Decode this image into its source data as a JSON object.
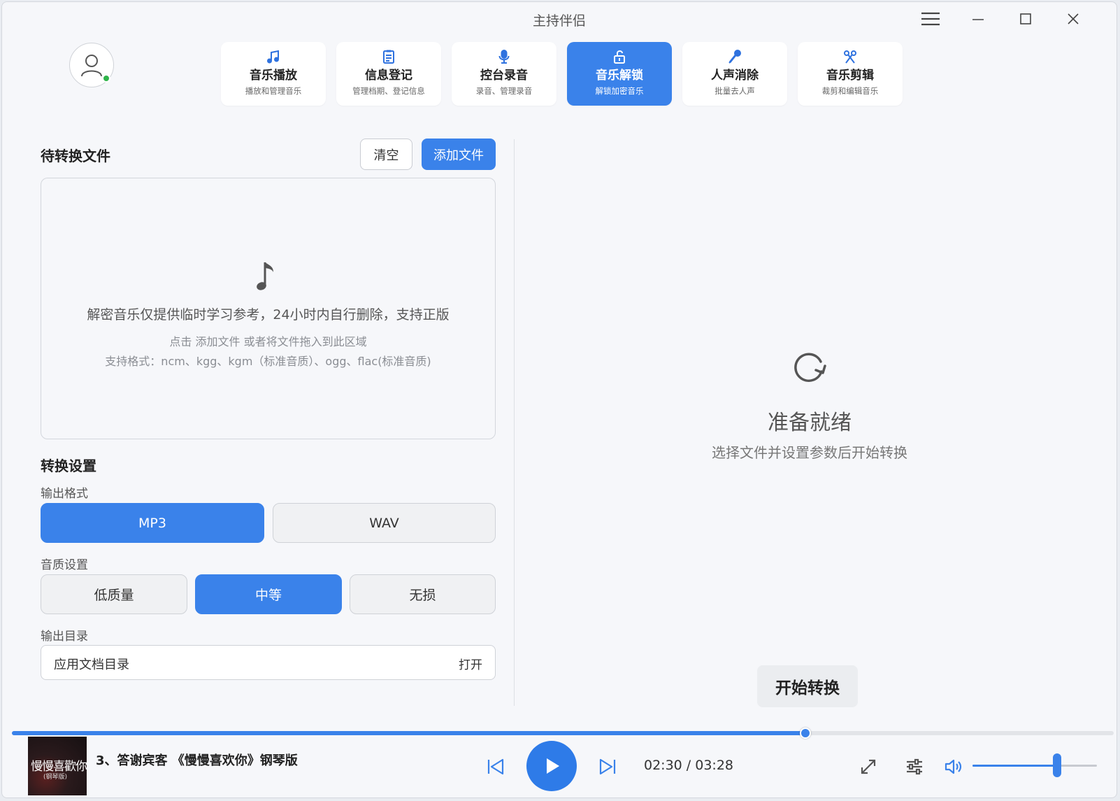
{
  "window": {
    "title": "主持伴侣"
  },
  "nav": [
    {
      "label": "音乐播放",
      "sub": "播放和管理音乐",
      "icon": "music-note-icon",
      "active": false
    },
    {
      "label": "信息登记",
      "sub": "管理档期、登记信息",
      "icon": "clipboard-icon",
      "active": false
    },
    {
      "label": "控台录音",
      "sub": "录音、管理录音",
      "icon": "microphone-icon",
      "active": false
    },
    {
      "label": "音乐解锁",
      "sub": "解锁加密音乐",
      "icon": "unlock-icon",
      "active": true
    },
    {
      "label": "人声消除",
      "sub": "批量去人声",
      "icon": "mic-remove-icon",
      "active": false
    },
    {
      "label": "音乐剪辑",
      "sub": "裁剪和编辑音乐",
      "icon": "scissors-icon",
      "active": false
    }
  ],
  "files": {
    "title": "待转换文件",
    "clear_label": "清空",
    "add_label": "添加文件",
    "note": "解密音乐仅提供临时学习参考，24小时内自行删除，支持正版",
    "hint": "点击 添加文件 或者将文件拖入到此区域",
    "formats": "支持格式：ncm、kgg、kgm（标准音质）、ogg、flac(标准音质)"
  },
  "settings": {
    "title": "转换设置",
    "format_label": "输出格式",
    "formats": [
      {
        "label": "MP3",
        "active": true
      },
      {
        "label": "WAV",
        "active": false
      }
    ],
    "quality_label": "音质设置",
    "qualities": [
      {
        "label": "低质量",
        "active": false
      },
      {
        "label": "中等",
        "active": true
      },
      {
        "label": "无损",
        "active": false
      }
    ],
    "dir_label": "输出目录",
    "dir_value": "应用文档目录",
    "dir_open": "打开"
  },
  "status": {
    "title": "准备就绪",
    "subtitle": "选择文件并设置参数后开始转换",
    "start_label": "开始转换"
  },
  "player": {
    "cover_title": "慢慢喜歡你",
    "cover_sub": "(钢琴版)",
    "track": "3、答谢宾客 《慢慢喜欢你》钢琴版",
    "time": "02:30 / 03:28",
    "progress": 0.72,
    "volume": 0.68,
    "accent": "#3a82ea"
  }
}
